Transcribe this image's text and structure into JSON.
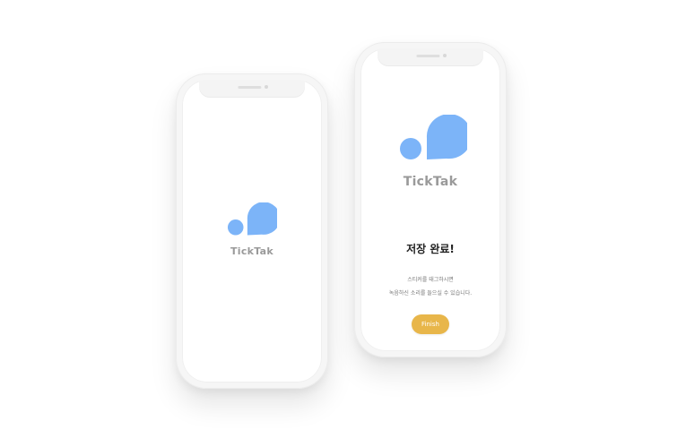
{
  "colors": {
    "logo_blue": "#7cb4f8",
    "brand_gray": "#9a9a9a",
    "finish_button": "#e8b64a",
    "background": "#ffffff"
  },
  "splash_screen": {
    "logo_icon": "ticktak-blob-logo",
    "brand_name": "TickTak"
  },
  "complete_screen": {
    "logo_icon": "ticktak-blob-logo",
    "brand_name": "TickTak",
    "title": "저장 완료!",
    "description_line1": "스티커를 태그하시면",
    "description_line2": "녹음하신 소리를 들으실 수 있습니다.",
    "finish_button": "Finish"
  }
}
